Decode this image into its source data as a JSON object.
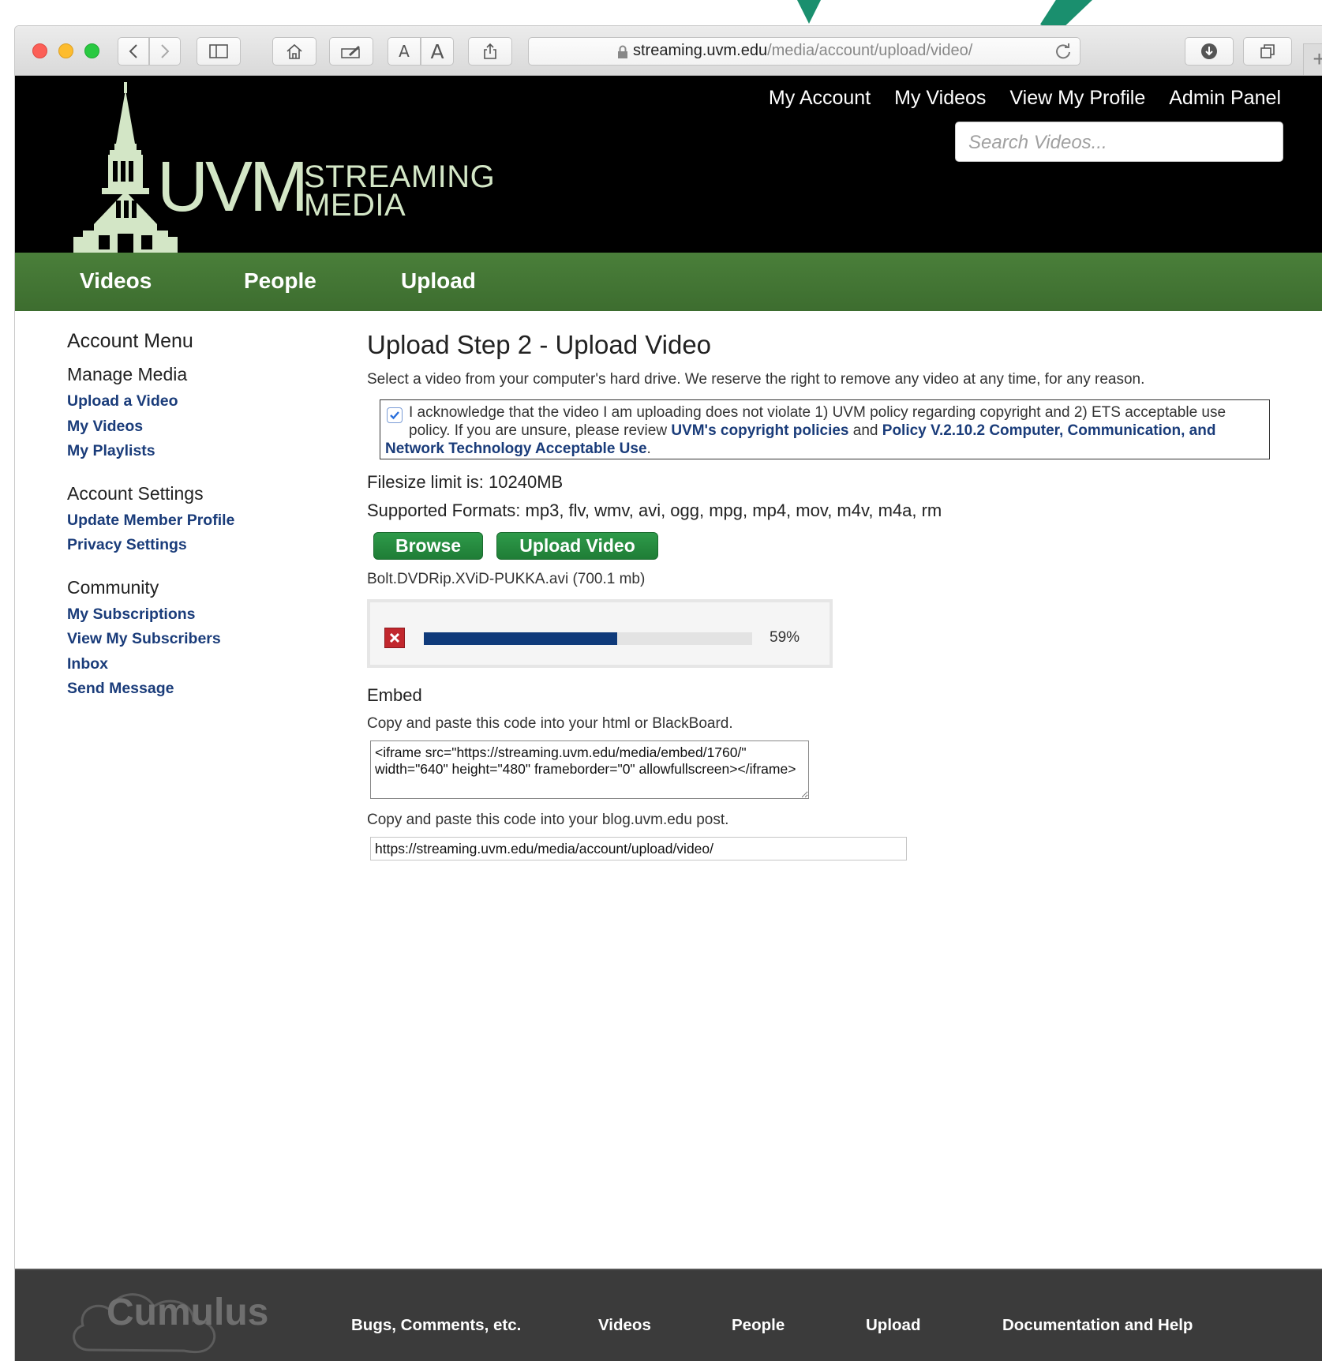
{
  "browser": {
    "url_host": "streaming.uvm.edu",
    "url_path": "/media/account/upload/video/",
    "text_size_small": "A",
    "text_size_large": "A"
  },
  "site": {
    "logo_uvm": "UVM",
    "logo_line1": "STREAMING",
    "logo_line2": "MEDIA",
    "topnav": [
      "My Account",
      "My Videos",
      "View My Profile",
      "Admin Panel"
    ],
    "search_placeholder": "Search Videos...",
    "mainnav": [
      "Videos",
      "People",
      "Upload"
    ]
  },
  "sidebar": {
    "title": "Account Menu",
    "groups": [
      {
        "heading": "Manage Media",
        "links": [
          "Upload a Video",
          "My Videos",
          "My Playlists"
        ]
      },
      {
        "heading": "Account Settings",
        "links": [
          "Update Member Profile",
          "Privacy Settings"
        ]
      },
      {
        "heading": "Community",
        "links": [
          "My Subscriptions",
          "View My Subscribers",
          "Inbox",
          "Send Message"
        ]
      }
    ]
  },
  "main": {
    "title": "Upload Step 2 - Upload Video",
    "intro": "Select a video from your computer's hard drive. We reserve the right to remove any video at any time, for any reason.",
    "ack_checked": true,
    "ack_text_1": "I acknowledge that the video I am uploading does not violate 1) UVM policy regarding copyright and 2) ETS acceptable use policy. If you are unsure, please review ",
    "ack_link_1": "UVM's copyright policies",
    "ack_text_2": " and ",
    "ack_link_2": "Policy V.2.10.2 Computer, Communication, and Network Technology Acceptable Use",
    "ack_text_3": ".",
    "filesize_limit": "Filesize limit is: 10240MB",
    "formats": "Supported Formats: mp3, flv, wmv, avi, ogg, mpg, mp4, mov, m4v, m4a, rm",
    "browse_label": "Browse",
    "upload_label": "Upload Video",
    "file_name": "Bolt.DVDRip.XViD-PUKKA.avi (700.1 mb)",
    "progress_percent": 59,
    "progress_text": "59%",
    "embed_heading": "Embed",
    "embed_help": "Copy and paste this code into your html or BlackBoard.",
    "embed_code": "<iframe src=\"https://streaming.uvm.edu/media/embed/1760/\" width=\"640\" height=\"480\" frameborder=\"0\" allowfullscreen></iframe>",
    "blog_help": "Copy and paste this code into your blog.uvm.edu post.",
    "blog_url": "https://streaming.uvm.edu/media/account/upload/video/"
  },
  "footer": {
    "logo_text": "Cumulus",
    "links": [
      "Bugs, Comments, etc.",
      "Videos",
      "People",
      "Upload",
      "Documentation and Help"
    ]
  },
  "colors": {
    "header_bg": "#000000",
    "nav_green": "#447535",
    "link_blue": "#1a3c7a",
    "button_green": "#26893f",
    "progress_fill": "#0f3a7a",
    "footer_bg": "#3b3b3b"
  }
}
